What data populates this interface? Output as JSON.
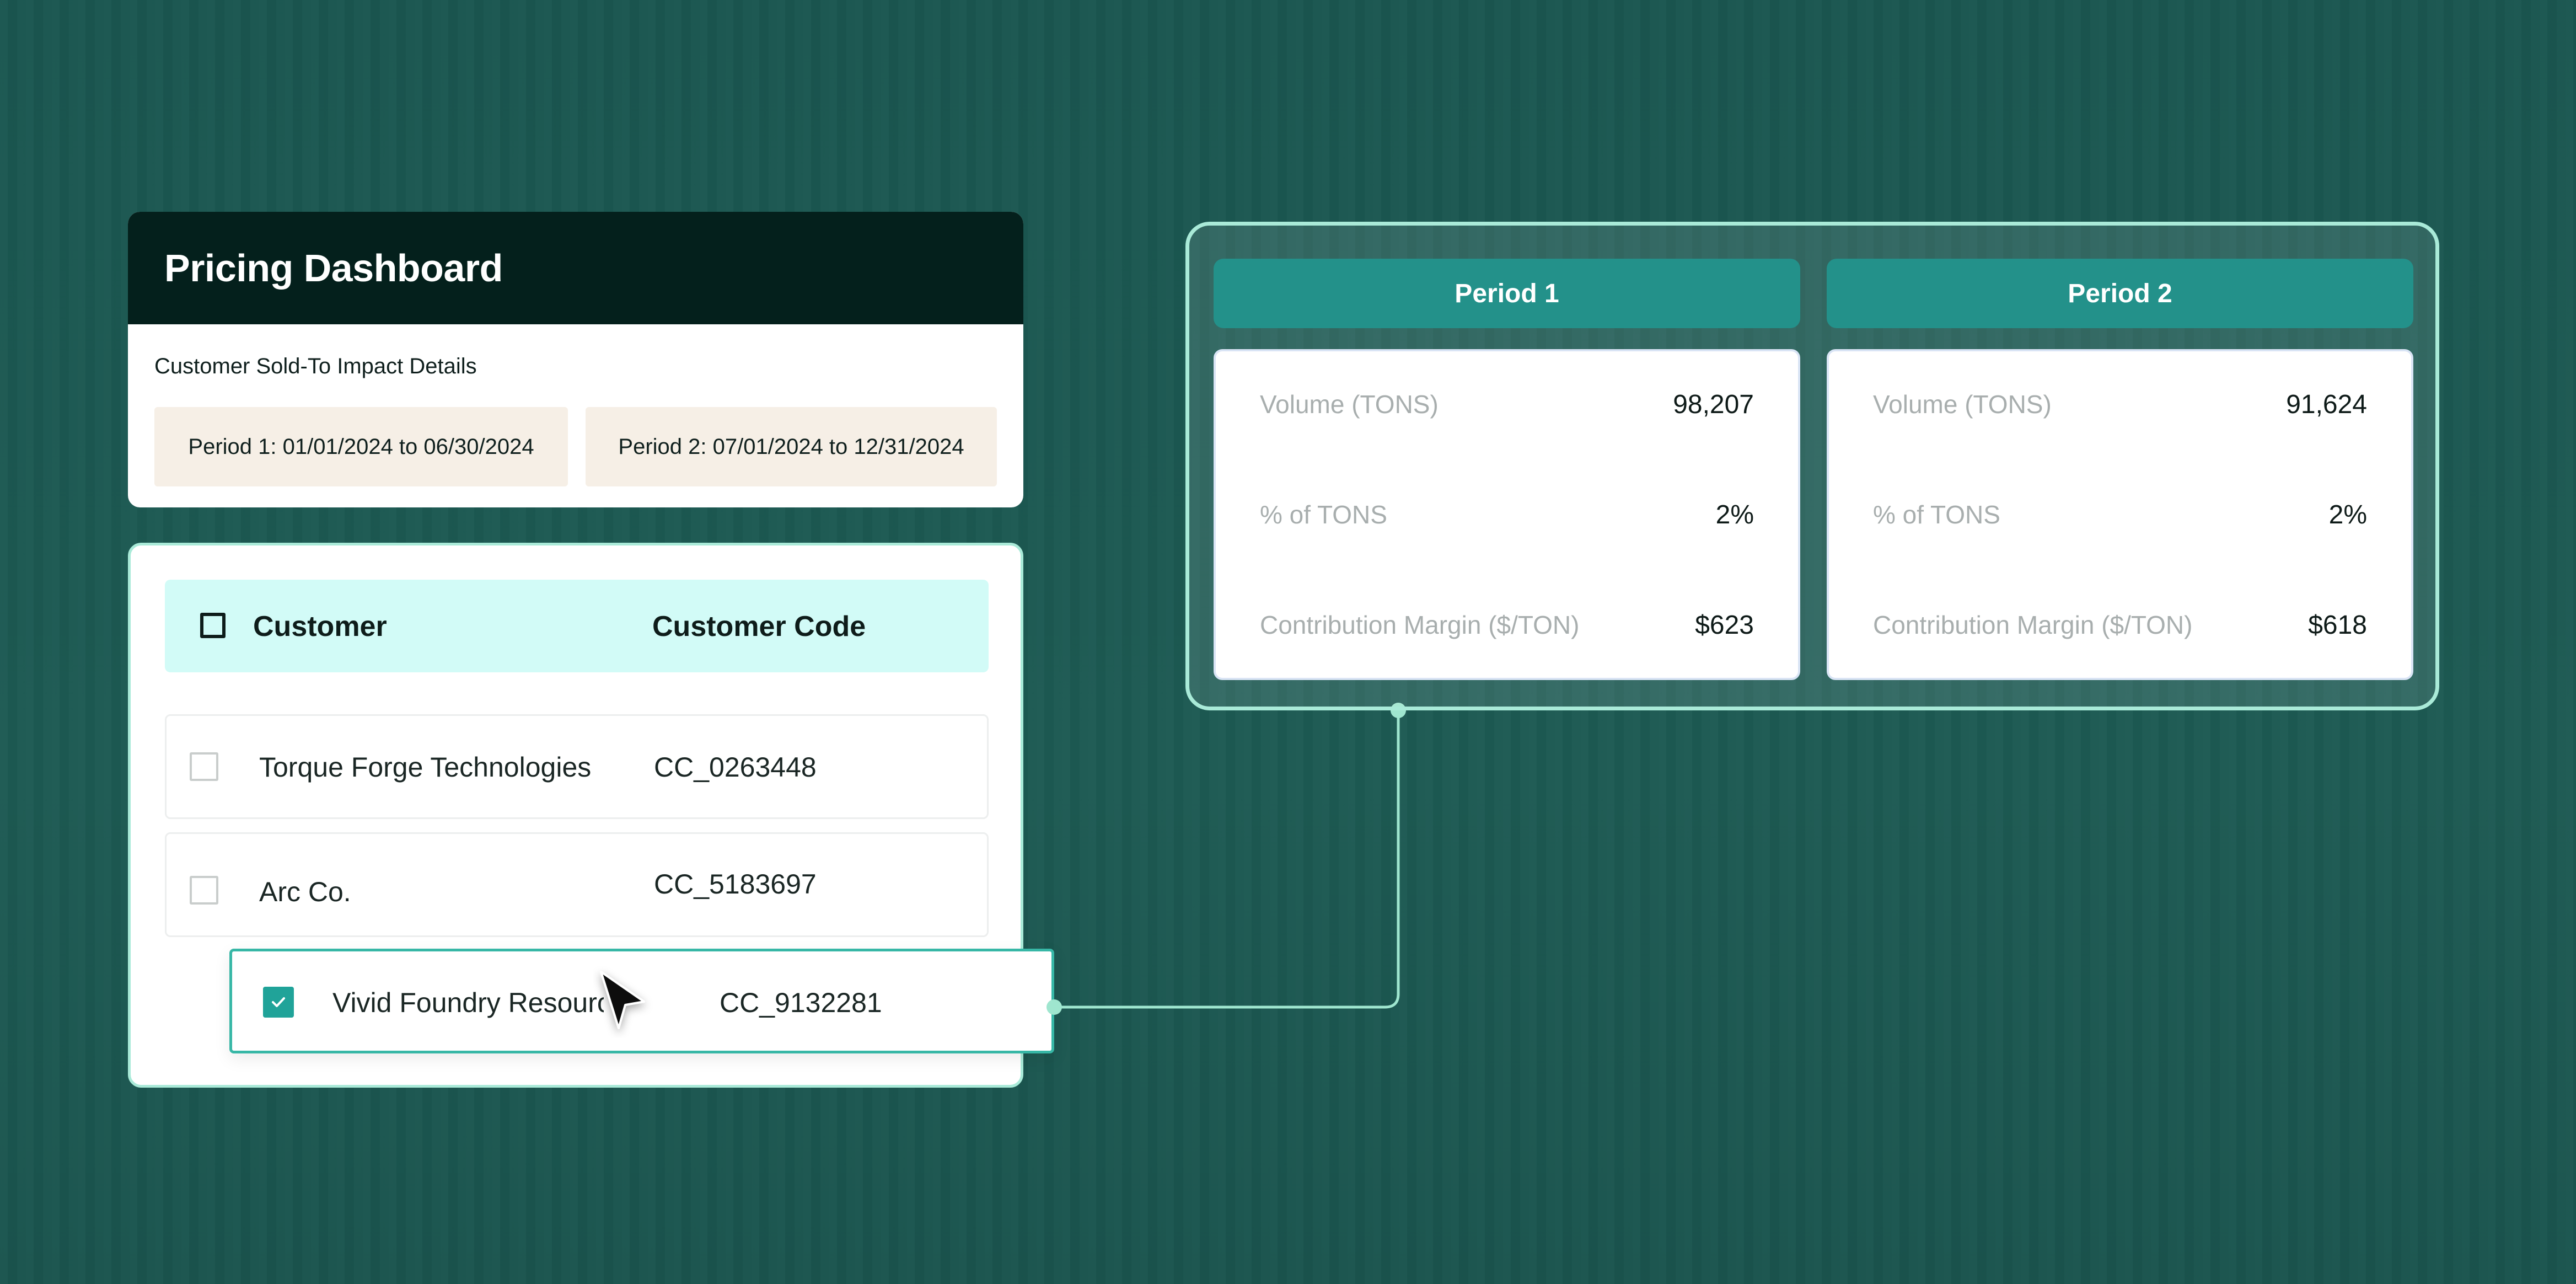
{
  "dashboard": {
    "title": "Pricing Dashboard",
    "subtitle": "Customer Sold-To Impact Details",
    "period1": "Period 1: 01/01/2024 to 06/30/2024",
    "period2": "Period 2: 07/01/2024 to 12/31/2024"
  },
  "table": {
    "headers": {
      "customer": "Customer",
      "code": "Customer Code"
    },
    "rows": [
      {
        "name": "Torque Forge Technologies",
        "code": "CC_0263448",
        "checked": false
      },
      {
        "name": "Arc Co.",
        "code": "CC_5183697",
        "checked": false
      },
      {
        "name": "Vivid Foundry Resources",
        "code": "CC_9132281",
        "checked": true
      }
    ]
  },
  "compare": {
    "periods": [
      {
        "label": "Period 1",
        "metrics": [
          {
            "label": "Volume (TONS)",
            "value": "98,207"
          },
          {
            "label": "% of TONS",
            "value": "2%"
          },
          {
            "label": "Contribution Margin ($/TON)",
            "value": "$623"
          }
        ]
      },
      {
        "label": "Period 2",
        "metrics": [
          {
            "label": "Volume (TONS)",
            "value": "91,624"
          },
          {
            "label": "% of TONS",
            "value": "2%"
          },
          {
            "label": "Contribution Margin ($/TON)",
            "value": "$618"
          }
        ]
      }
    ]
  },
  "colors": {
    "background": "#1c5650",
    "header_dark": "#04201c",
    "accent_teal": "#23918a",
    "accent_border": "#a9ead8",
    "table_header_bg": "#d2fbf7",
    "period_bg": "#f6efe6"
  }
}
